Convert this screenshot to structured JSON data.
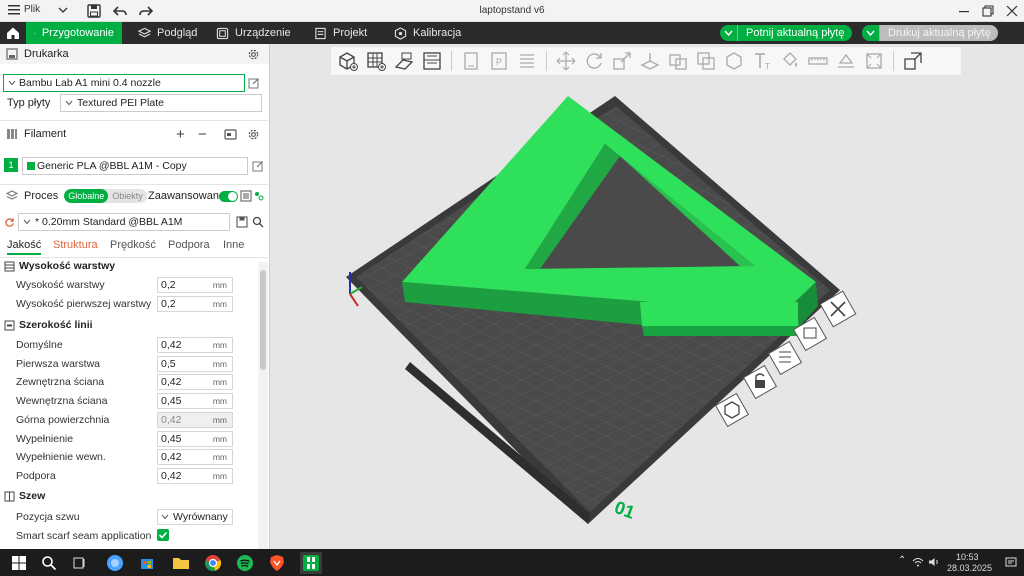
{
  "window": {
    "menu_label": "Plik",
    "title": "laptopstand v6"
  },
  "tabs": {
    "prepare": "Przygotowanie",
    "preview": "Podgląd",
    "device": "Urządzenie",
    "project": "Projekt",
    "calibration": "Kalibracja"
  },
  "actions": {
    "slice": "Potnij aktualną płytę",
    "print": "Drukuj aktualną płytę"
  },
  "printer": {
    "section_title": "Drukarka",
    "name": "Bambu Lab A1 mini 0.4 nozzle",
    "plate_label": "Typ płyty",
    "plate_value": "Textured PEI Plate"
  },
  "filament": {
    "section_title": "Filament",
    "slot_number": "1",
    "name": "Generic PLA @BBL A1M - Copy",
    "color": "#00ae42"
  },
  "process": {
    "section_title": "Proces",
    "toggle_global": "Globalne",
    "toggle_objects": "Obiekty",
    "advanced_label": "Zaawansowane",
    "preset": "* 0.20mm Standard @BBL A1M"
  },
  "subtabs": [
    "Jakość",
    "Struktura",
    "Prędkość",
    "Podpora",
    "Inne"
  ],
  "groups": {
    "layer_height": {
      "title": "Wysokość warstwy",
      "rows": [
        {
          "label": "Wysokość warstwy",
          "value": "0,2",
          "unit": "mm"
        },
        {
          "label": "Wysokość pierwszej warstwy",
          "value": "0,2",
          "unit": "mm"
        }
      ]
    },
    "line_width": {
      "title": "Szerokość linii",
      "rows": [
        {
          "label": "Domyślne",
          "value": "0,42",
          "unit": "mm"
        },
        {
          "label": "Pierwsza warstwa",
          "value": "0,5",
          "unit": "mm"
        },
        {
          "label": "Zewnętrzna ściana",
          "value": "0,42",
          "unit": "mm"
        },
        {
          "label": "Wewnętrzna ściana",
          "value": "0,45",
          "unit": "mm"
        },
        {
          "label": "Górna powierzchnia",
          "value": "0,42",
          "unit": "mm"
        },
        {
          "label": "Wypełnienie",
          "value": "0,45",
          "unit": "mm"
        },
        {
          "label": "Wypełnienie wewn.",
          "value": "0,42",
          "unit": "mm"
        },
        {
          "label": "Podpora",
          "value": "0,42",
          "unit": "mm"
        }
      ]
    },
    "seam": {
      "title": "Szew",
      "position_label": "Pozycja szwu",
      "position_value": "Wyrównany",
      "scarf_label": "Smart scarf seam application"
    }
  },
  "plate": {
    "number": "01"
  },
  "taskbar": {
    "time": "10:53",
    "date": "28.03.2025"
  },
  "colors": {
    "accent": "#00ae42",
    "model": "#2fe05a",
    "bed": "#4a4a4a"
  }
}
